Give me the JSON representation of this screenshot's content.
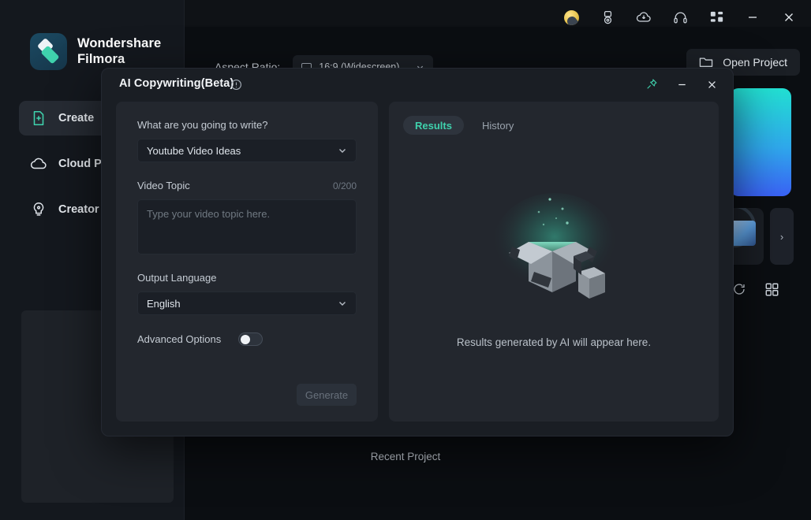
{
  "app": {
    "brand_line1": "Wondershare",
    "brand_line2": "Filmora",
    "accent_green": "#3fd2ad",
    "sidebar": {
      "items": [
        {
          "label": "Create ",
          "icon": "file-plus-icon",
          "active": true
        },
        {
          "label": "Cloud P",
          "icon": "cloud-icon",
          "active": false
        },
        {
          "label": "Creator",
          "icon": "lightbulb-icon",
          "active": false
        }
      ]
    },
    "toolbar": {
      "aspect_ratio_label": "Aspect Ratio:",
      "aspect_ratio_value": "16:9 (Widescreen)",
      "open_project_label": "Open Project"
    },
    "titlebar_icons": [
      "avatar-coin-icon",
      "medal-icon",
      "cloud-download-icon",
      "headset-icon",
      "grid-apps-icon",
      "minimize-icon",
      "close-icon"
    ],
    "recent_project_label": "Recent Project",
    "rail_icons": [
      "refresh-icon",
      "grid-view-icon"
    ],
    "next_arrow": "›"
  },
  "dialog": {
    "title": "AI Copywriting(Beta)",
    "info_icon": "info-icon",
    "controls": [
      "pin-icon",
      "minimize-icon",
      "close-icon"
    ],
    "form": {
      "write_label": "What are you going to write?",
      "write_value": "Youtube Video Ideas",
      "topic_label": "Video Topic",
      "topic_counter": "0/200",
      "topic_placeholder": "Type your video topic here.",
      "language_label": "Output Language",
      "language_value": "English",
      "advanced_label": "Advanced Options",
      "advanced_enabled": false,
      "generate_label": "Generate"
    },
    "results": {
      "tabs": [
        {
          "label": "Results",
          "active": true
        },
        {
          "label": "History",
          "active": false
        }
      ],
      "empty_text": "Results generated by AI will appear here.",
      "empty_art": "open-box-icon"
    }
  }
}
